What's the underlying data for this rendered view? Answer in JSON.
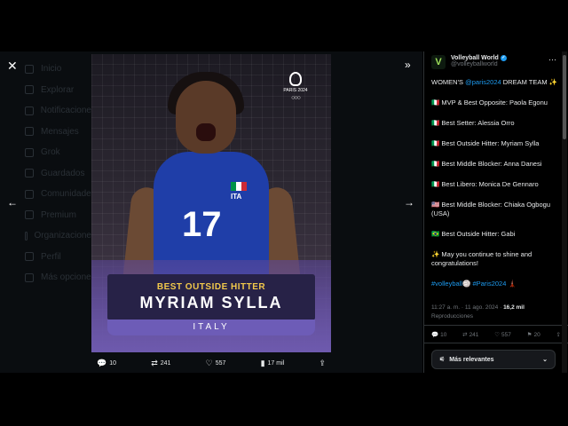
{
  "background_nav": [
    "Inicio",
    "Explorar",
    "Notificaciones",
    "Mensajes",
    "Grok",
    "Guardados",
    "Comunidades",
    "Premium",
    "Organizaciones",
    "Perfil",
    "Más opciones"
  ],
  "media": {
    "jersey_number": "17",
    "jersey_country": "ITA",
    "logo_text": "PARIS 2024",
    "caption_role": "BEST OUTSIDE HITTER",
    "caption_name": "MYRIAM SYLLA",
    "caption_country": "ITALY"
  },
  "media_actions": {
    "replies": "10",
    "reposts": "241",
    "likes": "557",
    "views": "17 mil"
  },
  "author": {
    "name": "Volleyball World",
    "handle": "@volleyballworld",
    "avatar_letter": "V"
  },
  "tweet": {
    "intro_pre": "WOMEN'S ",
    "intro_link": "@paris2024",
    "intro_post": " DREAM TEAM ✨",
    "lines": [
      "🇮🇹 MVP & Best Opposite: Paola Egonu",
      "🇮🇹 Best Setter: Alessia Orro",
      "🇮🇹 Best Outside Hitter: Myriam Sylla",
      "🇮🇹 Best Middle Blocker: Anna Danesi",
      "🇮🇹 Best Libero: Monica De Gennaro",
      "🇺🇸 Best Middle Blocker: Chiaka Ogbogu (USA)",
      "🇧🇷 Best Outside Hitter: Gabi",
      "✨ May you continue to shine and congratulations!"
    ],
    "hashtag_1": "#volleyball🏐",
    "hashtag_2": "#Paris2024",
    "hashtag_tail": " 🗼"
  },
  "meta": {
    "time": "11:27 a. m. · 11 ago. 2024 · ",
    "views_count": "16,2 mil",
    "views_label": "Reproducciones"
  },
  "stats": {
    "replies": "10",
    "reposts": "241",
    "likes": "557",
    "bookmarks": "20"
  },
  "reply_sort": {
    "label": "Más relevantes"
  },
  "colors": {
    "accent": "#1d9bf0",
    "caption_gold": "#f1c84b",
    "caption_purple": "#6d5cb7",
    "jersey_blue": "#1f3ea8"
  }
}
